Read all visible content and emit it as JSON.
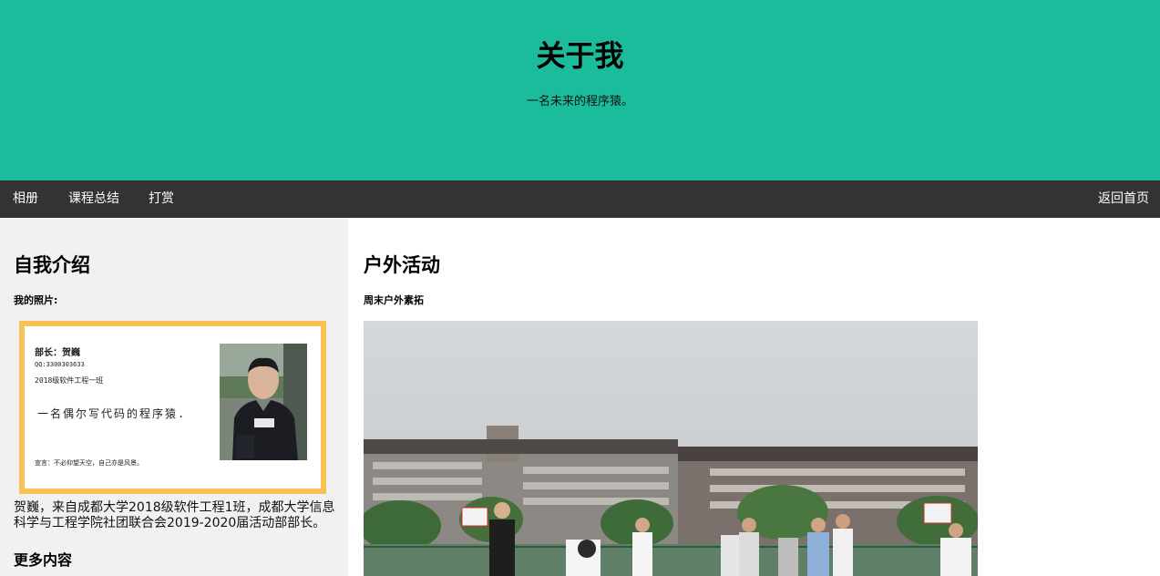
{
  "header": {
    "title": "关于我",
    "subtitle": "一名未来的程序猿。"
  },
  "nav": {
    "items": [
      "相册",
      "课程总结",
      "打赏"
    ],
    "right": "返回首页"
  },
  "sidebar": {
    "heading": "自我介绍",
    "photo_label": "我的照片:",
    "card": {
      "line1": "部长：贺巍",
      "line2": "QQ:3300303633",
      "line3": "2018级软件工程一班",
      "line4": "一名偶尔写代码的程序猿.",
      "line5": "宣言：不必仰望天空，自己亦是风景。"
    },
    "bio": "贺巍，来自成都大学2018级软件工程1班，成都大学信息科学与工程学院社团联合会2019-2020届活动部部长。",
    "more_heading": "更多内容"
  },
  "main": {
    "heading": "户外活动",
    "subheading": "周末户外素拓"
  },
  "colors": {
    "header_bg": "#1abc9c",
    "nav_bg": "#333333",
    "sidebar_bg": "#f1f1f1",
    "card_border": "#f7c153"
  }
}
